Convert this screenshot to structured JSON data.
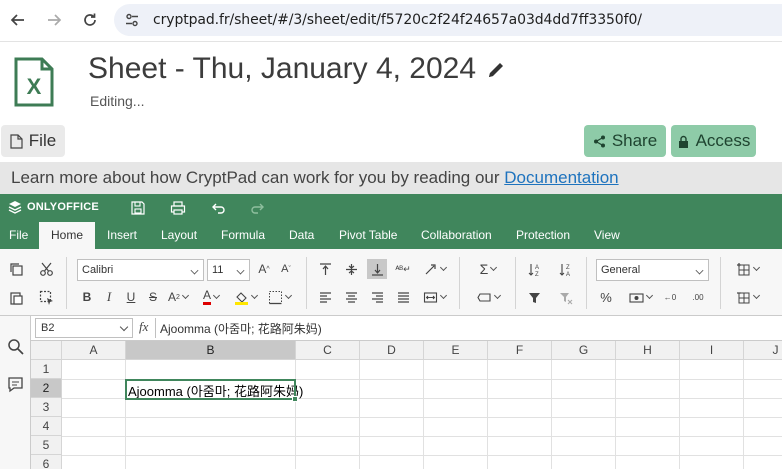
{
  "browser": {
    "url": "cryptpad.fr/sheet/#/3/sheet/edit/f5720c2f24f24657a03d4dd7ff3350f0/"
  },
  "document": {
    "title": "Sheet - Thu, January 4, 2024",
    "status": "Editing..."
  },
  "cp_toolbar": {
    "file_label": "File",
    "share_label": "Share",
    "access_label": "Access"
  },
  "banner": {
    "text": "Learn more about how CryptPad can work for you by reading our ",
    "link_text": "Documentation"
  },
  "onlyoffice": {
    "logo_text": "ONLYOFFICE",
    "tabs": [
      {
        "label": "File"
      },
      {
        "label": "Home"
      },
      {
        "label": "Insert"
      },
      {
        "label": "Layout"
      },
      {
        "label": "Formula"
      },
      {
        "label": "Data"
      },
      {
        "label": "Pivot Table"
      },
      {
        "label": "Collaboration"
      },
      {
        "label": "Protection"
      },
      {
        "label": "View"
      }
    ],
    "active_tab": "Home",
    "font_name": "Calibri",
    "font_size": "11",
    "number_format": "General",
    "bold": "B",
    "italic": "I",
    "underline": "U",
    "strike": "S",
    "percent": "%",
    "sum": "Σ"
  },
  "formula_bar": {
    "cell_ref": "B2",
    "fx": "fx",
    "content": "Ajoomma (아줌마; 花路阿朱妈)"
  },
  "grid": {
    "columns": [
      "A",
      "B",
      "C",
      "D",
      "E",
      "F",
      "G",
      "H",
      "I",
      "J"
    ],
    "rows": [
      "1",
      "2",
      "3",
      "4",
      "5",
      "6"
    ],
    "selected_column": "B",
    "selected_row": "2",
    "cell_b2": "Ajoomma (아줌마; 花路阿朱妈)"
  },
  "colors": {
    "oo_green": "#40865c",
    "share_green": "#8ecba8",
    "link_blue": "#1e73be"
  }
}
